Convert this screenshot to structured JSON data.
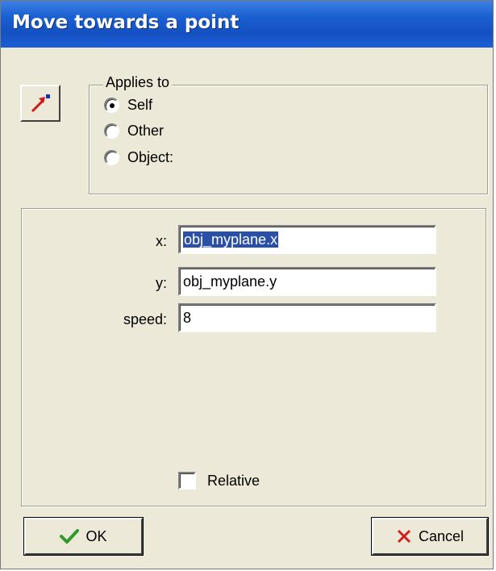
{
  "window": {
    "title": "Move towards a point"
  },
  "applies_to": {
    "legend": "Applies to",
    "options": [
      {
        "label": "Self",
        "checked": true
      },
      {
        "label": "Other",
        "checked": false
      },
      {
        "label": "Object:",
        "checked": false
      }
    ]
  },
  "fields": {
    "x": {
      "label": "x:",
      "value": "obj_myplane.x"
    },
    "y": {
      "label": "y:",
      "value": "obj_myplane.y"
    },
    "speed": {
      "label": "speed:",
      "value": "8"
    }
  },
  "relative": {
    "label": "Relative",
    "checked": false
  },
  "buttons": {
    "ok": "OK",
    "cancel": "Cancel"
  },
  "icons": {
    "action": "move-towards-arrow-icon",
    "ok": "check-icon",
    "cancel": "x-icon"
  },
  "colors": {
    "titlebar": "#1a5fd0",
    "ok_check": "#2e9a2e",
    "cancel_x": "#d02020",
    "selection": "#2a4fa8"
  }
}
